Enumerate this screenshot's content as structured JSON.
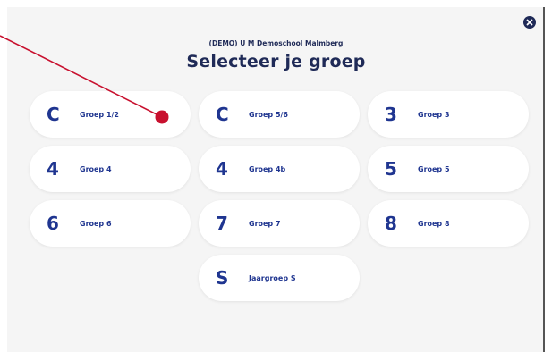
{
  "header": {
    "school_name": "(DEMO) U M Demoschool Malmberg",
    "title": "Selecteer je groep"
  },
  "groups": [
    {
      "letter": "C",
      "label": "Groep 1/2"
    },
    {
      "letter": "C",
      "label": "Groep 5/6"
    },
    {
      "letter": "3",
      "label": "Groep 3"
    },
    {
      "letter": "4",
      "label": "Groep 4"
    },
    {
      "letter": "4",
      "label": "Groep 4b"
    },
    {
      "letter": "5",
      "label": "Groep 5"
    },
    {
      "letter": "6",
      "label": "Groep 6"
    },
    {
      "letter": "7",
      "label": "Groep 7"
    },
    {
      "letter": "8",
      "label": "Groep 8"
    },
    {
      "letter": "S",
      "label": "Jaargroep S"
    }
  ],
  "colors": {
    "accent": "#1f3590",
    "title": "#1f2a57",
    "background": "#f5f5f5",
    "annotation": "#c8102e"
  }
}
